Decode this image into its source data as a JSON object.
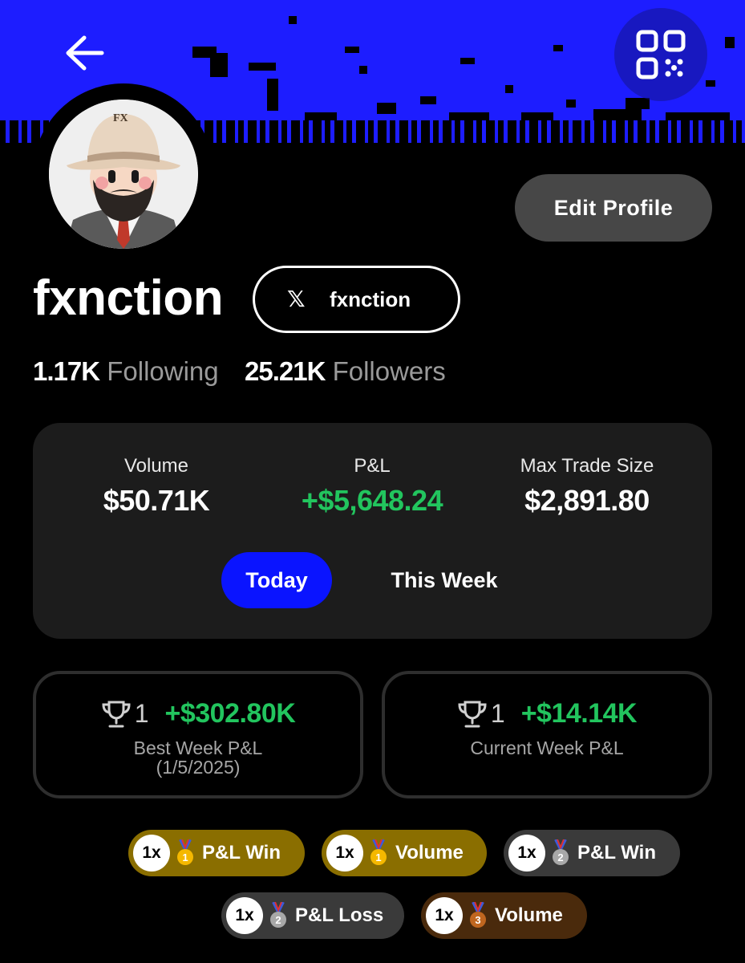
{
  "profile": {
    "username": "fxnction",
    "x_handle": "fxnction",
    "x_glyph": "𝕏",
    "avatar_hat_text": "FX",
    "edit_label": "Edit Profile",
    "following_count": "1.17K",
    "following_label": "Following",
    "followers_count": "25.21K",
    "followers_label": "Followers"
  },
  "stats": {
    "volume_label": "Volume",
    "volume_value": "$50.71K",
    "pnl_label": "P&L",
    "pnl_value": "+$5,648.24",
    "max_label": "Max Trade Size",
    "max_value": "$2,891.80",
    "tabs": [
      {
        "label": "Today",
        "active": true
      },
      {
        "label": "This Week",
        "active": false
      }
    ]
  },
  "weeks": {
    "best": {
      "rank": "1",
      "pnl": "+$302.80K",
      "caption": "Best Week P&L",
      "date": "(1/5/2025)"
    },
    "current": {
      "rank": "1",
      "pnl": "+$14.14K",
      "caption": "Current Week P&L"
    }
  },
  "badges": [
    {
      "count": "1x",
      "medal": "gold",
      "rank": "1",
      "label": "P&L Win"
    },
    {
      "count": "1x",
      "medal": "gold",
      "rank": "1",
      "label": "Volume"
    },
    {
      "count": "1x",
      "medal": "silver",
      "rank": "2",
      "label": "P&L Win"
    },
    {
      "count": "1x",
      "medal": "silver",
      "rank": "2",
      "label": "P&L Loss"
    },
    {
      "count": "1x",
      "medal": "bronze",
      "rank": "3",
      "label": "Volume"
    }
  ],
  "colors": {
    "banner": "#1d1dff",
    "accent_blue": "#0a14ff",
    "positive_green": "#22c55e",
    "card_bg": "#1c1c1c"
  },
  "icons": {
    "back": "arrow-left-icon",
    "qr": "qr-code-icon",
    "trophy": "trophy-icon",
    "medal": "medal-icon"
  }
}
